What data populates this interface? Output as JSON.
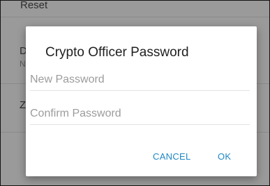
{
  "background_list": {
    "items": [
      {
        "title": "Reset",
        "subtitle": ""
      },
      {
        "title": "D",
        "subtitle": "N"
      },
      {
        "title": "Z",
        "subtitle": ""
      }
    ]
  },
  "dialog": {
    "title": "Crypto Officer Password",
    "new_password": {
      "value": "",
      "placeholder": "New Password"
    },
    "confirm_password": {
      "value": "",
      "placeholder": "Confirm Password"
    },
    "cancel_label": "CANCEL",
    "ok_label": "OK"
  },
  "colors": {
    "accent": "#1e88c4",
    "scrim": "#9a9a9a",
    "dialog_bg": "#ffffff"
  }
}
